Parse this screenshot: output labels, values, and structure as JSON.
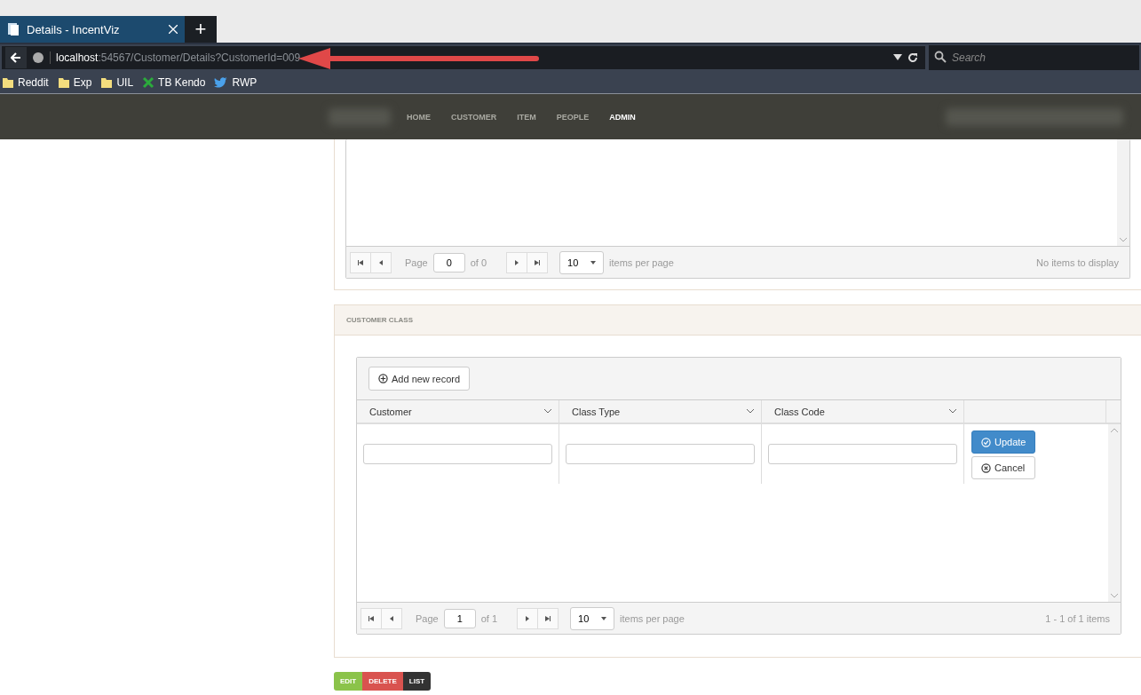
{
  "browser": {
    "tab": {
      "title": "Details - IncentViz",
      "selected": true
    },
    "new_tab": "+",
    "address": {
      "host": "localhost",
      "path": ":54567/Customer/Details?CustomerId=009"
    },
    "search": {
      "placeholder": "Search"
    },
    "bookmarks": [
      {
        "label": "Reddit",
        "kind": "folder"
      },
      {
        "label": "Exp",
        "kind": "folder"
      },
      {
        "label": "UIL",
        "kind": "folder"
      },
      {
        "label": "TB Kendo",
        "kind": "kendo"
      },
      {
        "label": "RWP",
        "kind": "bird"
      }
    ]
  },
  "nav": {
    "items": [
      {
        "label": "HOME",
        "selected": false
      },
      {
        "label": "CUSTOMER",
        "selected": false
      },
      {
        "label": "ITEM",
        "selected": false
      },
      {
        "label": "PEOPLE",
        "selected": false
      },
      {
        "label": "ADMIN",
        "selected": true
      }
    ]
  },
  "top_grid": {
    "pager": {
      "page_label": "Page",
      "page": "0",
      "of": "of 0",
      "page_size": "10",
      "items_per_page": "items per page",
      "info": "No items to display"
    }
  },
  "customer_class": {
    "title": "CUSTOMER CLASS",
    "add_button": "Add new record",
    "columns": [
      "Customer",
      "Class Type",
      "Class Code"
    ],
    "edit_row": {
      "update": "Update",
      "cancel": "Cancel"
    },
    "pager": {
      "page_label": "Page",
      "page": "1",
      "of": "of 1",
      "page_size": "10",
      "items_per_page": "items per page",
      "info": "1 - 1 of 1 items"
    }
  },
  "actions": [
    {
      "label": "EDIT",
      "kind": "edit"
    },
    {
      "label": "DELETE",
      "kind": "delete"
    },
    {
      "label": "LIST",
      "kind": "list"
    }
  ]
}
